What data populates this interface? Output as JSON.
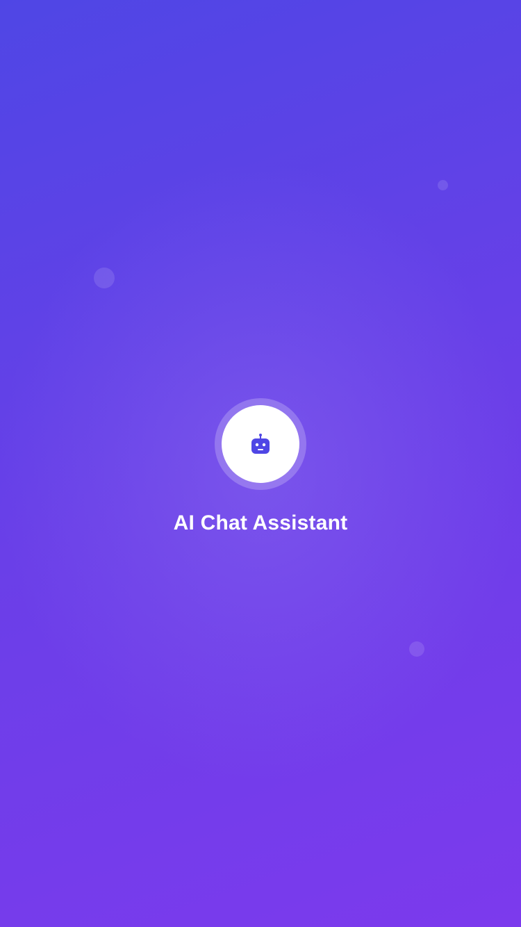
{
  "splash": {
    "app_title": "AI Chat Assistant",
    "logo_icon": "robot-icon"
  },
  "colors": {
    "background_start": "#4f46e5",
    "background_end": "#7c3aed",
    "logo_background": "#ffffff",
    "icon_color": "#4f46e5",
    "title_color": "#ffffff"
  }
}
